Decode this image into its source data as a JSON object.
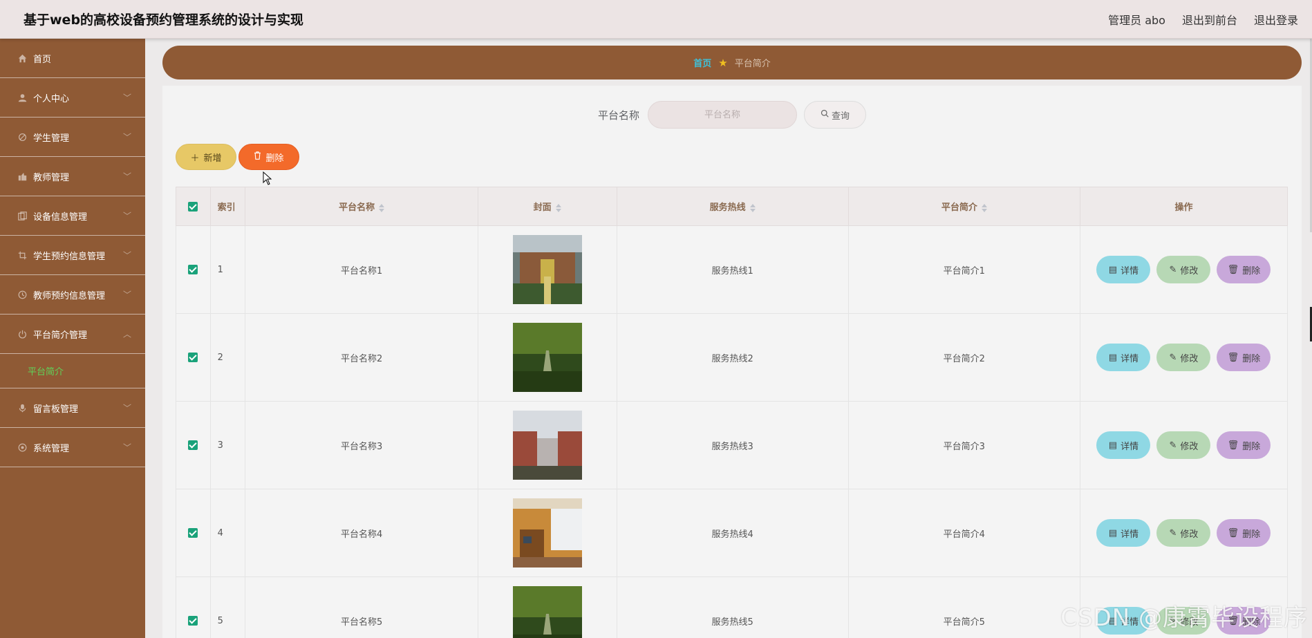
{
  "header": {
    "title": "基于web的高校设备预约管理系统的设计与实现",
    "admin": "管理员 abo",
    "frontend": "退出到前台",
    "logout": "退出登录"
  },
  "sidebar": {
    "items": [
      {
        "label": "首页",
        "icon": "home-icon"
      },
      {
        "label": "个人中心",
        "icon": "user-icon"
      },
      {
        "label": "学生管理",
        "icon": "student-icon"
      },
      {
        "label": "教师管理",
        "icon": "teacher-icon"
      },
      {
        "label": "设备信息管理",
        "icon": "device-icon"
      },
      {
        "label": "学生预约信息管理",
        "icon": "crop-icon"
      },
      {
        "label": "教师预约信息管理",
        "icon": "clock-icon"
      },
      {
        "label": "平台简介管理",
        "icon": "power-icon"
      },
      {
        "label": "留言板管理",
        "icon": "mic-icon"
      },
      {
        "label": "系统管理",
        "icon": "settings-icon"
      }
    ],
    "sub_active": "平台简介"
  },
  "breadcrumb": {
    "home": "首页",
    "current": "平台简介"
  },
  "search": {
    "label": "平台名称",
    "placeholder": "平台名称",
    "button": "查询"
  },
  "actions": {
    "add": "新增",
    "delete": "删除"
  },
  "table": {
    "headers": {
      "index": "索引",
      "name": "平台名称",
      "cover": "封面",
      "hotline": "服务热线",
      "intro": "平台简介",
      "ops": "操作"
    },
    "rows": [
      {
        "index": "1",
        "name": "平台名称1",
        "hotline": "服务热线1",
        "intro": "平台简介1"
      },
      {
        "index": "2",
        "name": "平台名称2",
        "hotline": "服务热线2",
        "intro": "平台简介2"
      },
      {
        "index": "3",
        "name": "平台名称3",
        "hotline": "服务热线3",
        "intro": "平台简介3"
      },
      {
        "index": "4",
        "name": "平台名称4",
        "hotline": "服务热线4",
        "intro": "平台简介4"
      },
      {
        "index": "5",
        "name": "平台名称5",
        "hotline": "服务热线5",
        "intro": "平台简介5"
      }
    ],
    "row_actions": {
      "detail": "详情",
      "edit": "修改",
      "delete": "删除"
    }
  },
  "watermark": "CSDN @康霄毕设程序",
  "colors": {
    "sidebar": "#8f5a35",
    "accent_green": "#1aa27a",
    "detail": "#8fd8e4",
    "edit": "#b7d8b5",
    "delete": "#c8a8da"
  }
}
